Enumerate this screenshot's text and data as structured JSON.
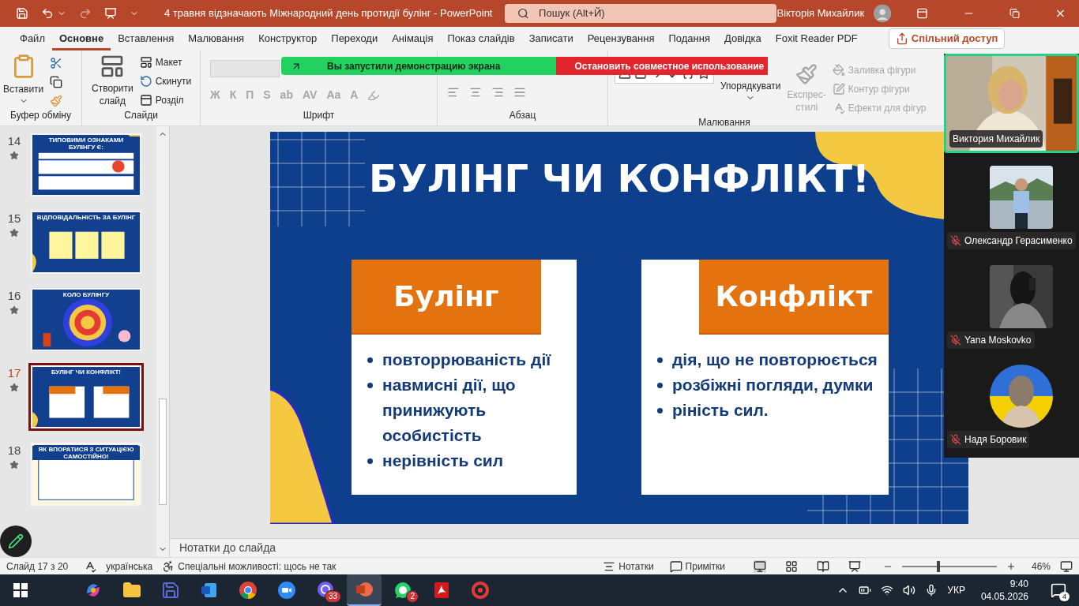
{
  "title_bar": {
    "title": "4 травня відзначають Міжнародний день протидії булінг  -  PowerPoint",
    "search": {
      "placeholder": "Пошук (Alt+Й)"
    },
    "user": "Вікторія Михайлик"
  },
  "tabs": [
    {
      "label": "Файл",
      "selected": false
    },
    {
      "label": "Основне",
      "selected": true
    },
    {
      "label": "Вставлення",
      "selected": false
    },
    {
      "label": "Малювання",
      "selected": false
    },
    {
      "label": "Конструктор",
      "selected": false
    },
    {
      "label": "Переходи",
      "selected": false
    },
    {
      "label": "Анімація",
      "selected": false
    },
    {
      "label": "Показ слайдів",
      "selected": false
    },
    {
      "label": "Записати",
      "selected": false
    },
    {
      "label": "Рецензування",
      "selected": false
    },
    {
      "label": "Подання",
      "selected": false
    },
    {
      "label": "Довідка",
      "selected": false
    },
    {
      "label": "Foxit Reader PDF",
      "selected": false
    }
  ],
  "share_button": "Спільний доступ",
  "ribbon": {
    "clipboard": {
      "paste": "Вставити",
      "label": "Буфер обміну"
    },
    "slides": {
      "new_slide": [
        "Створити",
        "слайд"
      ],
      "layout": "Макет",
      "reset": "Скинути",
      "section": "Розділ",
      "label": "Слайди"
    },
    "font": {
      "label": "Шрифт",
      "disabled": true,
      "buttons": [
        "Ж",
        "К",
        "П",
        "S",
        "ab",
        "AV",
        "Aa",
        "A"
      ]
    },
    "paragraph": {
      "label": "Абзац"
    },
    "drawing": {
      "label": "Малювання",
      "arrange": "Упорядкувати",
      "quick_styles": [
        "Експрес-",
        "стилі"
      ],
      "quick_styles_disabled": true,
      "commands": [
        {
          "label": "Заливка фігури",
          "disabled": true
        },
        {
          "label": "Контур фігури",
          "disabled": true
        },
        {
          "label": "Ефекти для фігур",
          "disabled": true
        }
      ]
    }
  },
  "share_banner": {
    "status": "Вы запустили демонстрацию экрана",
    "stop": "Остановить совместное использование"
  },
  "thumbnails": [
    {
      "number": "14",
      "title": "ТИПОВИМИ ОЗНАКАМИ БУЛІНГУ Є:",
      "kind": "list",
      "selected": false
    },
    {
      "number": "15",
      "title": "ВІДПОВІДАЛЬНІСТЬ ЗА БУЛІНГ",
      "kind": "columns",
      "selected": false
    },
    {
      "number": "16",
      "title": "КОЛО БУЛІНГУ",
      "kind": "circle",
      "selected": false
    },
    {
      "number": "17",
      "title": "БУЛІНГ ЧИ КОНФЛІКТ!",
      "kind": "cards",
      "selected": true
    },
    {
      "number": "18",
      "title": "ЯК ВПОРАТИСЯ З СИТУАЦІЄЮ САМОСТІЙНО!",
      "kind": "text",
      "selected": false
    }
  ],
  "slide": {
    "title": "БУЛІНГ ЧИ КОНФЛІКТ!",
    "cards": [
      {
        "heading": "Булінг",
        "heading_right": false,
        "items": [
          "повторрюваність дії",
          "навмисні дії, що принижують особистість",
          "нерівність сил"
        ]
      },
      {
        "heading": "Конфлікт",
        "heading_right": true,
        "items": [
          "дія, що не повторюється",
          "розбіжні погляди, думки",
          "ріність сил."
        ]
      }
    ]
  },
  "notes": {
    "placeholder": "Нотатки до слайда"
  },
  "meeting": {
    "participants": [
      {
        "name": "Виктория Михайлик",
        "kind": "camera",
        "muted": false,
        "speaking": true
      },
      {
        "name": "Олександр Герасименко",
        "muted": true,
        "speaking": false
      },
      {
        "name": "Yana Moskovko",
        "muted": true,
        "speaking": false
      },
      {
        "name": "Надя Боровик",
        "kind": "round",
        "muted": true,
        "speaking": false
      }
    ]
  },
  "status_bar": {
    "slide": "Слайд 17 з 20",
    "language": "українська",
    "accessibility": "Спеціальні можливості: щось не так",
    "notes": "Нотатки",
    "comments": "Примітки",
    "zoom": {
      "level": 0.38,
      "reading": "46%"
    }
  },
  "taskbar": {
    "apps": [
      {
        "kind": "copilot",
        "selected": false
      },
      {
        "kind": "folder",
        "selected": false
      },
      {
        "kind": "floppy",
        "selected": false
      },
      {
        "kind": "word",
        "selected": false
      },
      {
        "kind": "chrome",
        "selected": false
      },
      {
        "kind": "zoom",
        "selected": false
      },
      {
        "kind": "viber",
        "selected": false,
        "badge": "33"
      },
      {
        "kind": "powerpoint",
        "selected": true
      },
      {
        "kind": "whatsapp",
        "selected": false,
        "badge": "2"
      },
      {
        "kind": "pdf",
        "selected": false
      },
      {
        "kind": "ring",
        "selected": false
      }
    ],
    "language": "УКР",
    "time": "9:40",
    "date": "04.05.2026",
    "notifications": "4"
  }
}
